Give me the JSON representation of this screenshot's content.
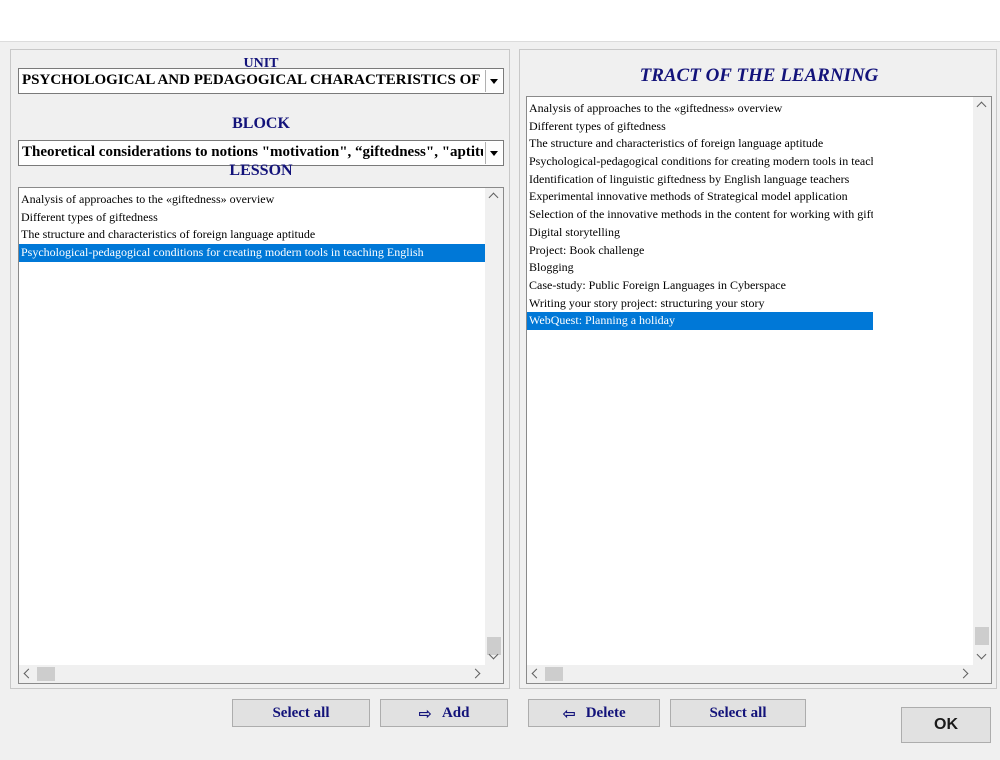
{
  "labels": {
    "unit": "UNIT",
    "block": "BLOCK",
    "lesson": "LESSON",
    "tract_title": "TRACT OF THE LEARNING"
  },
  "unit_select": {
    "value": "PSYCHOLOGICAL AND PEDAGOGICAL CHARACTERISTICS OF GIFTEDNESS"
  },
  "block_select": {
    "value": "Theoretical considerations to notions \"motivation\", “giftedness\", \"aptitude\""
  },
  "lesson_list": {
    "items": [
      "Analysis of approaches to the «giftedness» overview",
      "Different types of giftedness",
      "The structure and characteristics of foreign language aptitude",
      "Psychological-pedagogical conditions for creating modern tools in teaching English"
    ],
    "selected_index": 3
  },
  "tract_list": {
    "items": [
      "Analysis of approaches to the «giftedness» overview",
      "Different types of giftedness",
      "The structure and characteristics of foreign language aptitude",
      "Psychological-pedagogical conditions for creating modern tools in teaching English",
      "Identification of linguistic giftedness by English language teachers",
      "Experimental innovative methods of Strategical model application",
      "Selection of the innovative methods in the content for working with gifted students",
      "Digital storytelling",
      "Project: Book challenge",
      "Blogging",
      "Case-study: Public Foreign Languages in Cyberspace",
      "Writing your story project: structuring your story",
      "WebQuest: Planning a holiday"
    ],
    "selected_index": 12
  },
  "buttons": {
    "select_all_left": "Select all",
    "add": "Add",
    "delete": "Delete",
    "select_all_right": "Select all",
    "ok": "OK"
  },
  "icons": {
    "add": "arrow-right-outline-icon",
    "delete": "arrow-left-outline-icon"
  },
  "colors": {
    "label_navy": "#13137a",
    "selection_blue": "#0078d7"
  }
}
